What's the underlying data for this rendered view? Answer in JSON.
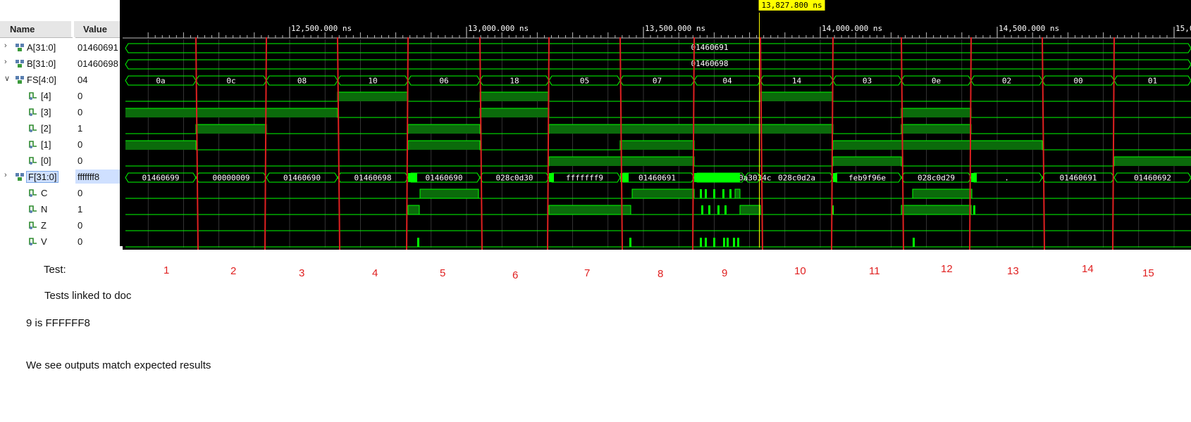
{
  "columns": {
    "name": "Name",
    "value": "Value"
  },
  "signals": [
    {
      "name": "A[31:0]",
      "value": "01460691",
      "kind": "bus",
      "expand": ">"
    },
    {
      "name": "B[31:0]",
      "value": "01460698",
      "kind": "bus",
      "expand": ">"
    },
    {
      "name": "FS[4:0]",
      "value": "04",
      "kind": "bus",
      "expand": "v"
    },
    {
      "name": "[4]",
      "value": "0",
      "kind": "bit",
      "expand": ""
    },
    {
      "name": "[3]",
      "value": "0",
      "kind": "bit",
      "expand": ""
    },
    {
      "name": "[2]",
      "value": "1",
      "kind": "bit",
      "expand": ""
    },
    {
      "name": "[1]",
      "value": "0",
      "kind": "bit",
      "expand": ""
    },
    {
      "name": "[0]",
      "value": "0",
      "kind": "bit",
      "expand": ""
    },
    {
      "name": "F[31:0]",
      "value": "fffffff8",
      "kind": "bus",
      "expand": ">"
    },
    {
      "name": "C",
      "value": "0",
      "kind": "bit",
      "expand": ""
    },
    {
      "name": "N",
      "value": "1",
      "kind": "bit",
      "expand": ""
    },
    {
      "name": "Z",
      "value": "0",
      "kind": "bit",
      "expand": ""
    },
    {
      "name": "V",
      "value": "0",
      "kind": "bit",
      "expand": ""
    }
  ],
  "timeline": {
    "ticks": [
      "12,500.000 ns",
      "13,000.000 ns",
      "13,500.000 ns",
      "14,000.000 ns",
      "14,500.000 ns",
      "15,0"
    ],
    "cursor": "13,827.800 ns"
  },
  "busA": "01460691",
  "busB": "01460698",
  "fs_values": [
    "0a",
    "0c",
    "08",
    "10",
    "06",
    "18",
    "05",
    "07",
    "04",
    "14",
    "03",
    "0e",
    "02",
    "00",
    "01"
  ],
  "f_values": [
    "01460699",
    "00000009",
    "01460690",
    "01460698",
    "01460690",
    "028c0d30",
    "fffffff9",
    "01460691",
    "..",
    "00a3034c",
    "028c0d2a",
    "feb9f96e",
    "028c0d29",
    ".",
    "01460691",
    "01460692"
  ],
  "annotations": {
    "test_label": "Test:",
    "test_numbers": [
      "1",
      "2",
      "3",
      "4",
      "5",
      "6",
      "7",
      "8",
      "9",
      "10",
      "11",
      "12",
      "13",
      "14",
      "15"
    ],
    "linked": "Tests linked to doc",
    "note9": "9 is FFFFFF8",
    "conclusion": "We see outputs match expected results"
  },
  "colors": {
    "wave": "#00ff00",
    "fill": "#0b6b0b",
    "marker": "#e02020",
    "cursor": "#ffff00",
    "text": "#111111"
  }
}
